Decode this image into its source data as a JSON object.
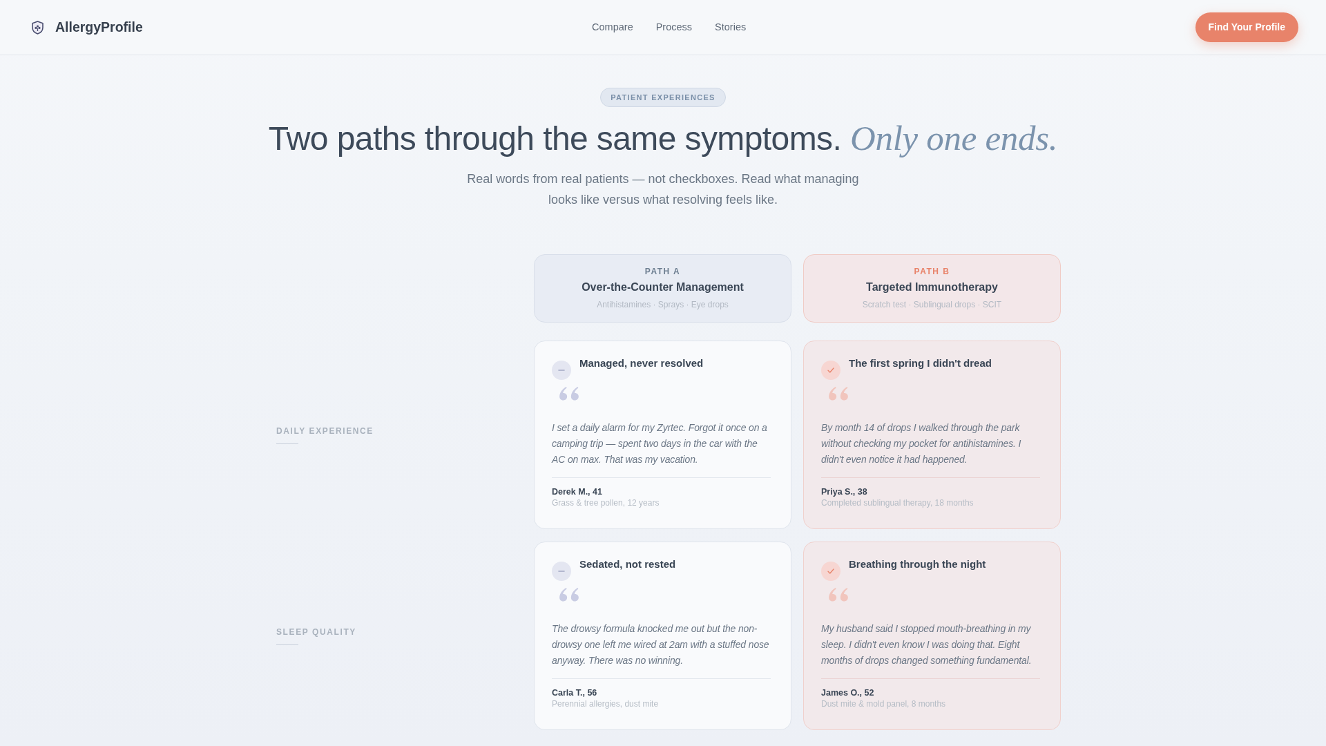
{
  "nav": {
    "brand": "AllergyProfile",
    "links": [
      "Compare",
      "Process",
      "Stories"
    ],
    "cta": "Find Your Profile"
  },
  "hero": {
    "eyebrow": "PATIENT EXPERIENCES",
    "headline": "Two paths through the same symptoms. *Only one ends.*",
    "intro": "Real words from real patients — not checkboxes. Read what managing looks like versus what resolving feels like."
  },
  "paths": [
    {
      "kind": "managed",
      "label": "PATH A",
      "title": "Over-the-Counter Management",
      "methods": "Antihistamines · Sprays · Eye drops"
    },
    {
      "kind": "resolved",
      "label": "PATH B",
      "title": "Targeted Immunotherapy",
      "methods": "Scratch test · Sublingual drops · SCIT"
    }
  ],
  "rows": [
    {
      "label": "DAILY EXPERIENCE",
      "stories": [
        {
          "title": "Managed, never resolved",
          "quote": "I set a daily alarm for my Zyrtec. Forgot it once on a camping trip — spent two days in the car with the AC on max. That was my vacation.",
          "author": "Derek M., 41",
          "detail": "Grass & tree pollen, 12 years"
        },
        {
          "title": "The first spring I didn't dread",
          "quote": "By month 14 of drops I walked through the park without checking my pocket for antihistamines. I didn't even notice it had happened.",
          "author": "Priya S., 38",
          "detail": "Completed sublingual therapy, 18 months"
        }
      ]
    },
    {
      "label": "SLEEP QUALITY",
      "stories": [
        {
          "title": "Sedated, not rested",
          "quote": "The drowsy formula knocked me out but the non-drowsy one left me wired at 2am with a stuffed nose anyway. There was no winning.",
          "author": "Carla T., 56",
          "detail": "Perennial allergies, dust mite"
        },
        {
          "title": "Breathing through the night",
          "quote": "My husband said I stopped mouth-breathing in my sleep. I didn't even know I was doing that. Eight months of drops changed something fundamental.",
          "author": "James O., 52",
          "detail": "Dust mite & mold panel, 8 months"
        }
      ]
    }
  ]
}
